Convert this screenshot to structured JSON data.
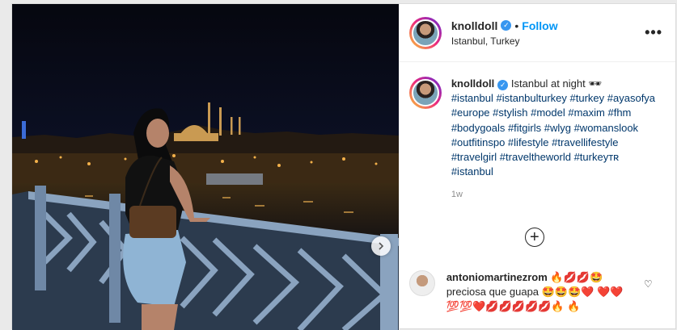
{
  "post": {
    "username": "knolldoll",
    "follow_label": "Follow",
    "dot": "•",
    "location": "Istanbul, Turkey",
    "more_label": "•••",
    "caption_text": " Istanbul at night 🕶",
    "hashtags": "#istanbul #istanbulturkey #turkey #ayasofya #europe #stylish #model #maxim #fhm #bodygoals #fitgirls #wlyg #womanslook #outfitinspo #lifestyle #travellifestyle #travelgirl #traveltheworld #turkeyᴛʀ #istanbul",
    "time_ago": "1w",
    "load_more_icon": "plus-circle-icon",
    "verified_icon": "✓"
  },
  "comment": {
    "username": "antoniomartinezrom",
    "text": " 🔥💋💋🤩 preciosa que guapa 🤩🤩🤩❤️ ❤️❤️💯💯❤️💋💋💋💋💋🔥 🔥",
    "like_icon": "♡"
  },
  "colors": {
    "link_blue": "#0095f6",
    "hashtag": "#00376b",
    "verified": "#3897f0"
  }
}
